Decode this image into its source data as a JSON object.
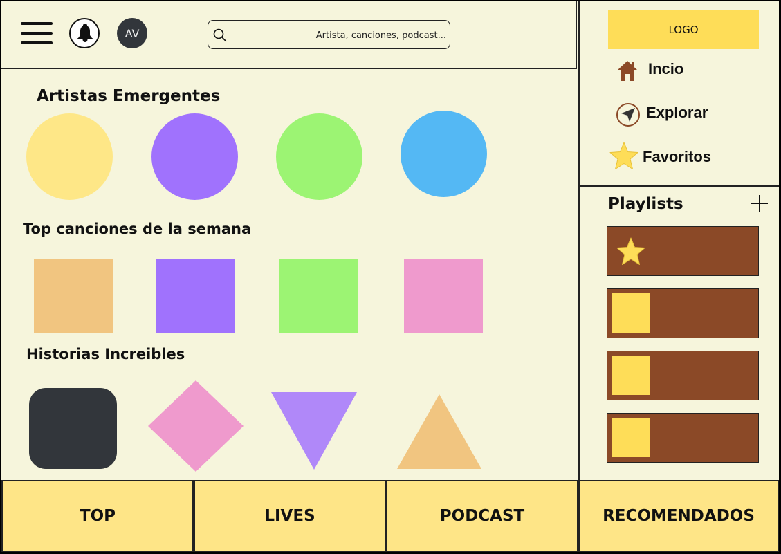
{
  "header": {
    "avatar_initials": "AV",
    "search": {
      "placeholder": "Artista, canciones, podcast..."
    }
  },
  "sections": {
    "artists": {
      "title": "Artistas Emergentes",
      "colors": [
        "#fee787",
        "#a072fd",
        "#9cf473",
        "#54b8f4"
      ]
    },
    "top_songs": {
      "title": "Top canciones de la semana",
      "colors": [
        "#f1c580",
        "#a072fd",
        "#9cf473",
        "#ef9acd"
      ]
    },
    "stories": {
      "title": "Historias Increibles",
      "colors": [
        "#32363b",
        "#ef9acd",
        "#b088f9",
        "#f1c580"
      ]
    }
  },
  "sidebar": {
    "logo": "LOGO",
    "nav": [
      {
        "label": "Incio",
        "icon": "home-icon"
      },
      {
        "label": "Explorar",
        "icon": "compass-icon"
      },
      {
        "label": "Favoritos",
        "icon": "star-icon"
      }
    ],
    "playlists_title": "Playlists"
  },
  "footer": {
    "tabs": [
      "TOP",
      "LIVES",
      "PODCAST",
      "RECOMENDADOS"
    ]
  },
  "colors": {
    "background": "#f6f5dc",
    "accent_yellow": "#fedd58",
    "playlist_brown": "#8b4927",
    "footer_yellow": "#fee587",
    "nav_icon_brown": "#8b4927"
  }
}
